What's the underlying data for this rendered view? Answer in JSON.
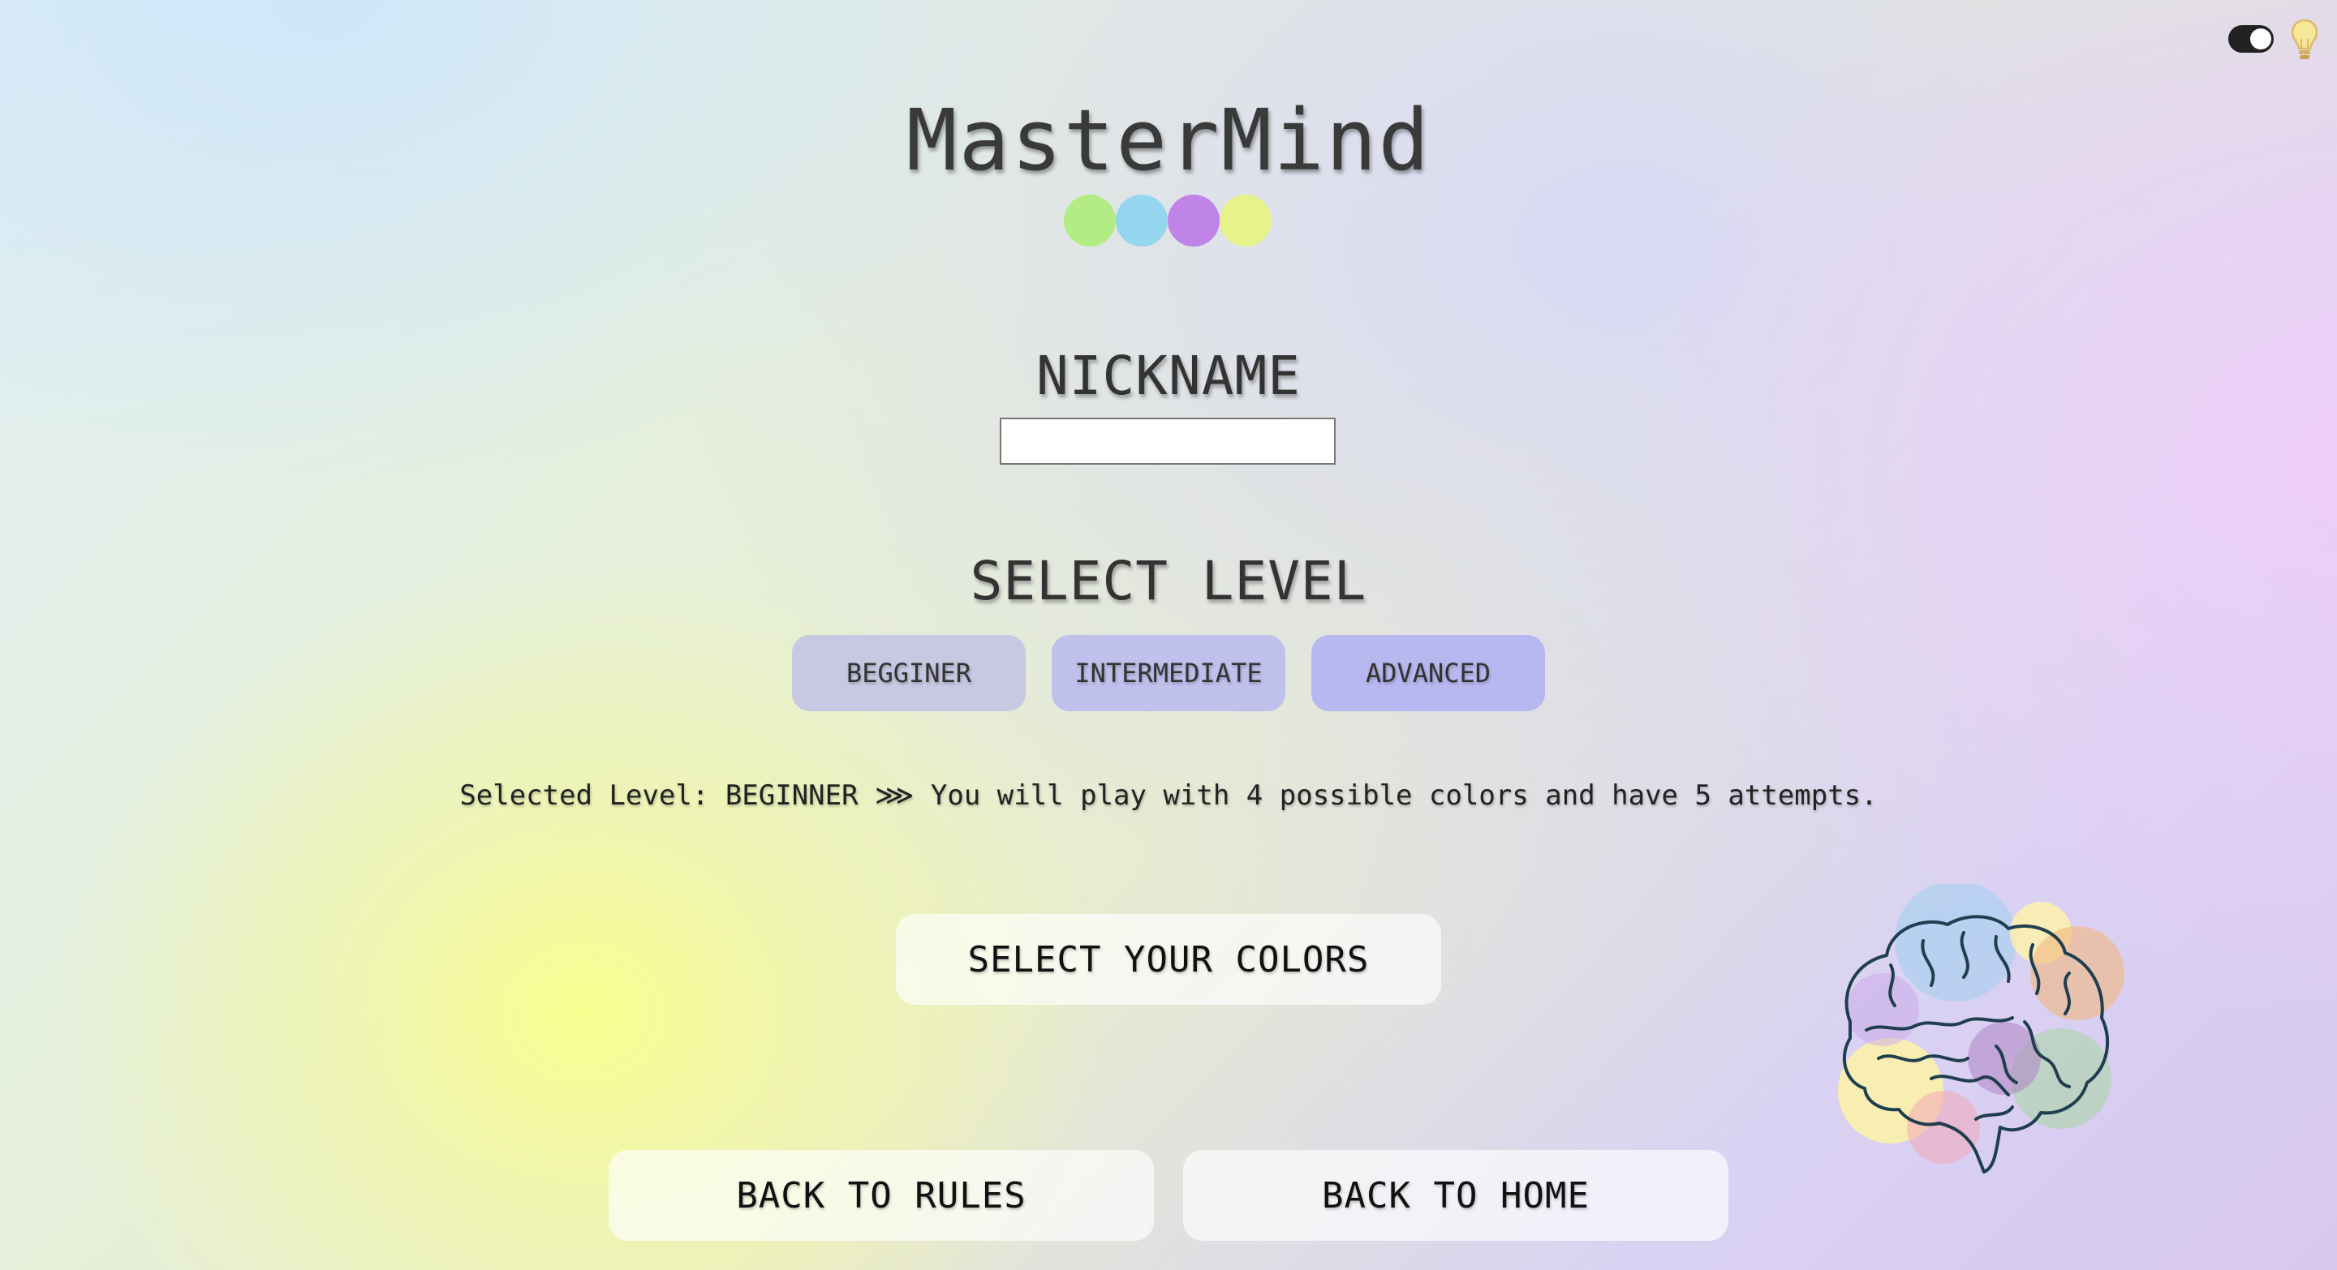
{
  "app": {
    "title": "MasterMind"
  },
  "theme_toggle": {
    "icon_toggle": "toggle-switch-icon",
    "icon_bulb": "lightbulb-icon"
  },
  "logo_dots": {
    "colors": [
      "#b3ec84",
      "#93d6ee",
      "#c083e8",
      "#e6f28a"
    ]
  },
  "nickname": {
    "label": "NICKNAME",
    "value": "",
    "placeholder": ""
  },
  "level": {
    "heading": "SELECT LEVEL",
    "options": [
      {
        "label": "BEGGINER",
        "color": "#c7c8e2"
      },
      {
        "label": "INTERMEDIATE",
        "color": "#bfc0eb"
      },
      {
        "label": "ADVANCED",
        "color": "#b8b8f0"
      }
    ],
    "selected_text": "Selected Level: BEGINNER ⋙ You will play with 4 possible colors and have 5 attempts."
  },
  "actions": {
    "select_colors": "SELECT YOUR COLORS",
    "back_to_rules": "BACK TO RULES",
    "back_to_home": "BACK TO HOME"
  },
  "illustration": {
    "icon": "brain-illustration"
  }
}
